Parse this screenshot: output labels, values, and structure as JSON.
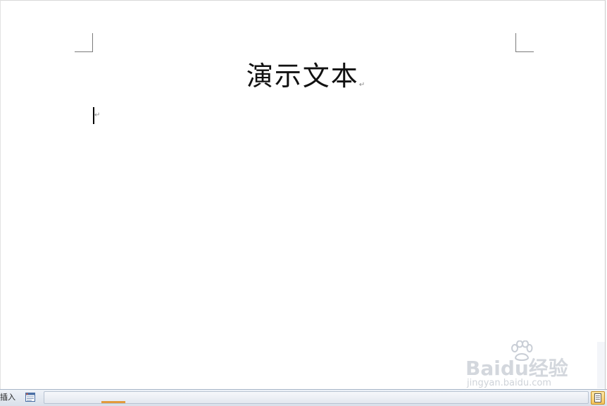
{
  "document": {
    "title": "演示文本",
    "paragraph_mark": "↵"
  },
  "watermark": {
    "logo_text": "Baidu经验",
    "url": "jingyan.baidu.com"
  },
  "status_bar": {
    "mode_label": "插入"
  },
  "icons": {
    "status": "document-stats-icon",
    "view": "print-layout-view-icon",
    "watermark_paw": "baidu-paw-icon"
  },
  "colors": {
    "status_bar": "#dfe6ef",
    "scroll_thumb": "#e29a3c",
    "active_view": "#f6c45a"
  }
}
